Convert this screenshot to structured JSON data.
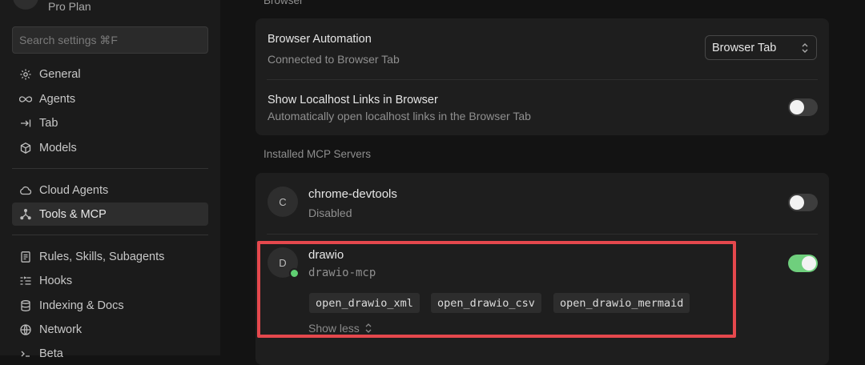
{
  "sidebar": {
    "plan": "Pro Plan",
    "search_placeholder": "Search settings ⌘F",
    "items": [
      {
        "label": "General",
        "icon": "gear-icon"
      },
      {
        "label": "Agents",
        "icon": "infinity-icon"
      },
      {
        "label": "Tab",
        "icon": "tab-arrow-icon"
      },
      {
        "label": "Models",
        "icon": "cube-icon"
      },
      {
        "label": "Cloud Agents",
        "icon": "cloud-icon"
      },
      {
        "label": "Tools & MCP",
        "icon": "tools-icon",
        "active": true
      },
      {
        "label": "Rules, Skills, Subagents",
        "icon": "document-icon"
      },
      {
        "label": "Hooks",
        "icon": "hooks-icon"
      },
      {
        "label": "Indexing & Docs",
        "icon": "database-icon"
      },
      {
        "label": "Network",
        "icon": "globe-icon"
      },
      {
        "label": "Beta",
        "icon": "beta-icon"
      }
    ]
  },
  "browser": {
    "section_label": "Browser",
    "automation_title": "Browser Automation",
    "automation_sub": "Connected to Browser Tab",
    "select_value": "Browser Tab",
    "localhost_title": "Show Localhost Links in Browser",
    "localhost_sub": "Automatically open localhost links in the Browser Tab",
    "localhost_enabled": false
  },
  "mcp": {
    "section_label": "Installed MCP Servers",
    "servers": [
      {
        "initial": "C",
        "name": "chrome-devtools",
        "status": "Disabled",
        "enabled": false
      },
      {
        "initial": "D",
        "name": "drawio",
        "package": "drawio-mcp",
        "enabled": true,
        "tools": [
          "open_drawio_xml",
          "open_drawio_csv",
          "open_drawio_mermaid"
        ],
        "show_less": "Show less"
      }
    ]
  },
  "colors": {
    "accent_green": "#6fcf7d",
    "highlight_red": "#e5484d",
    "background": "#131313"
  }
}
